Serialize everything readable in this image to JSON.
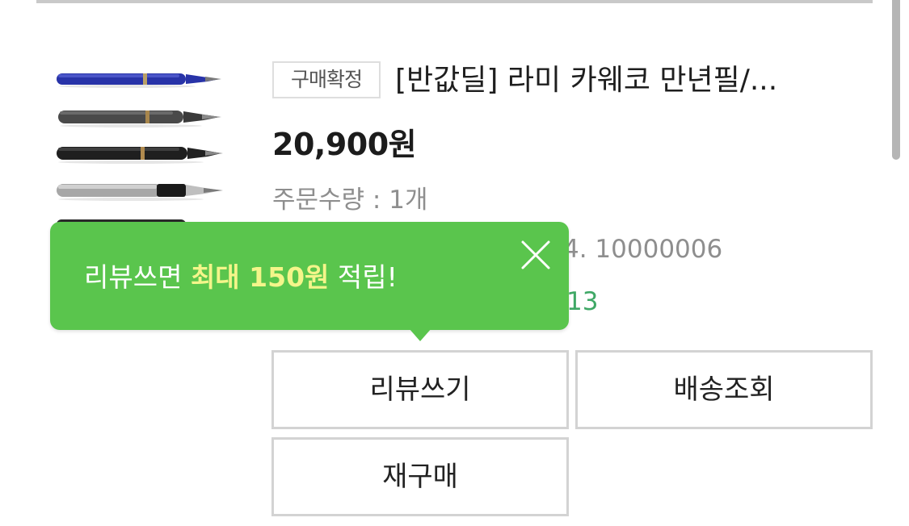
{
  "product": {
    "badge": "구매확정",
    "title": "[반값딜] 라미 카웨코 만년필/...",
    "price": "20,900원",
    "quantity": "주문수량 : 1개",
    "order_number": "4. 10000006",
    "status_partial": "13",
    "image_icon": "fountain-pens-image"
  },
  "tooltip": {
    "prefix": "리뷰쓰면 ",
    "highlight": "최대 150원",
    "suffix": " 적립!",
    "close_icon": "close-icon"
  },
  "buttons": {
    "review": "리뷰쓰기",
    "delivery": "배송조회",
    "reorder": "재구매"
  },
  "colors": {
    "tooltip_bg": "#5ac54d",
    "tooltip_highlight": "#f4f58a",
    "status_green": "#3fa866",
    "muted_text": "#8e8e8e"
  }
}
